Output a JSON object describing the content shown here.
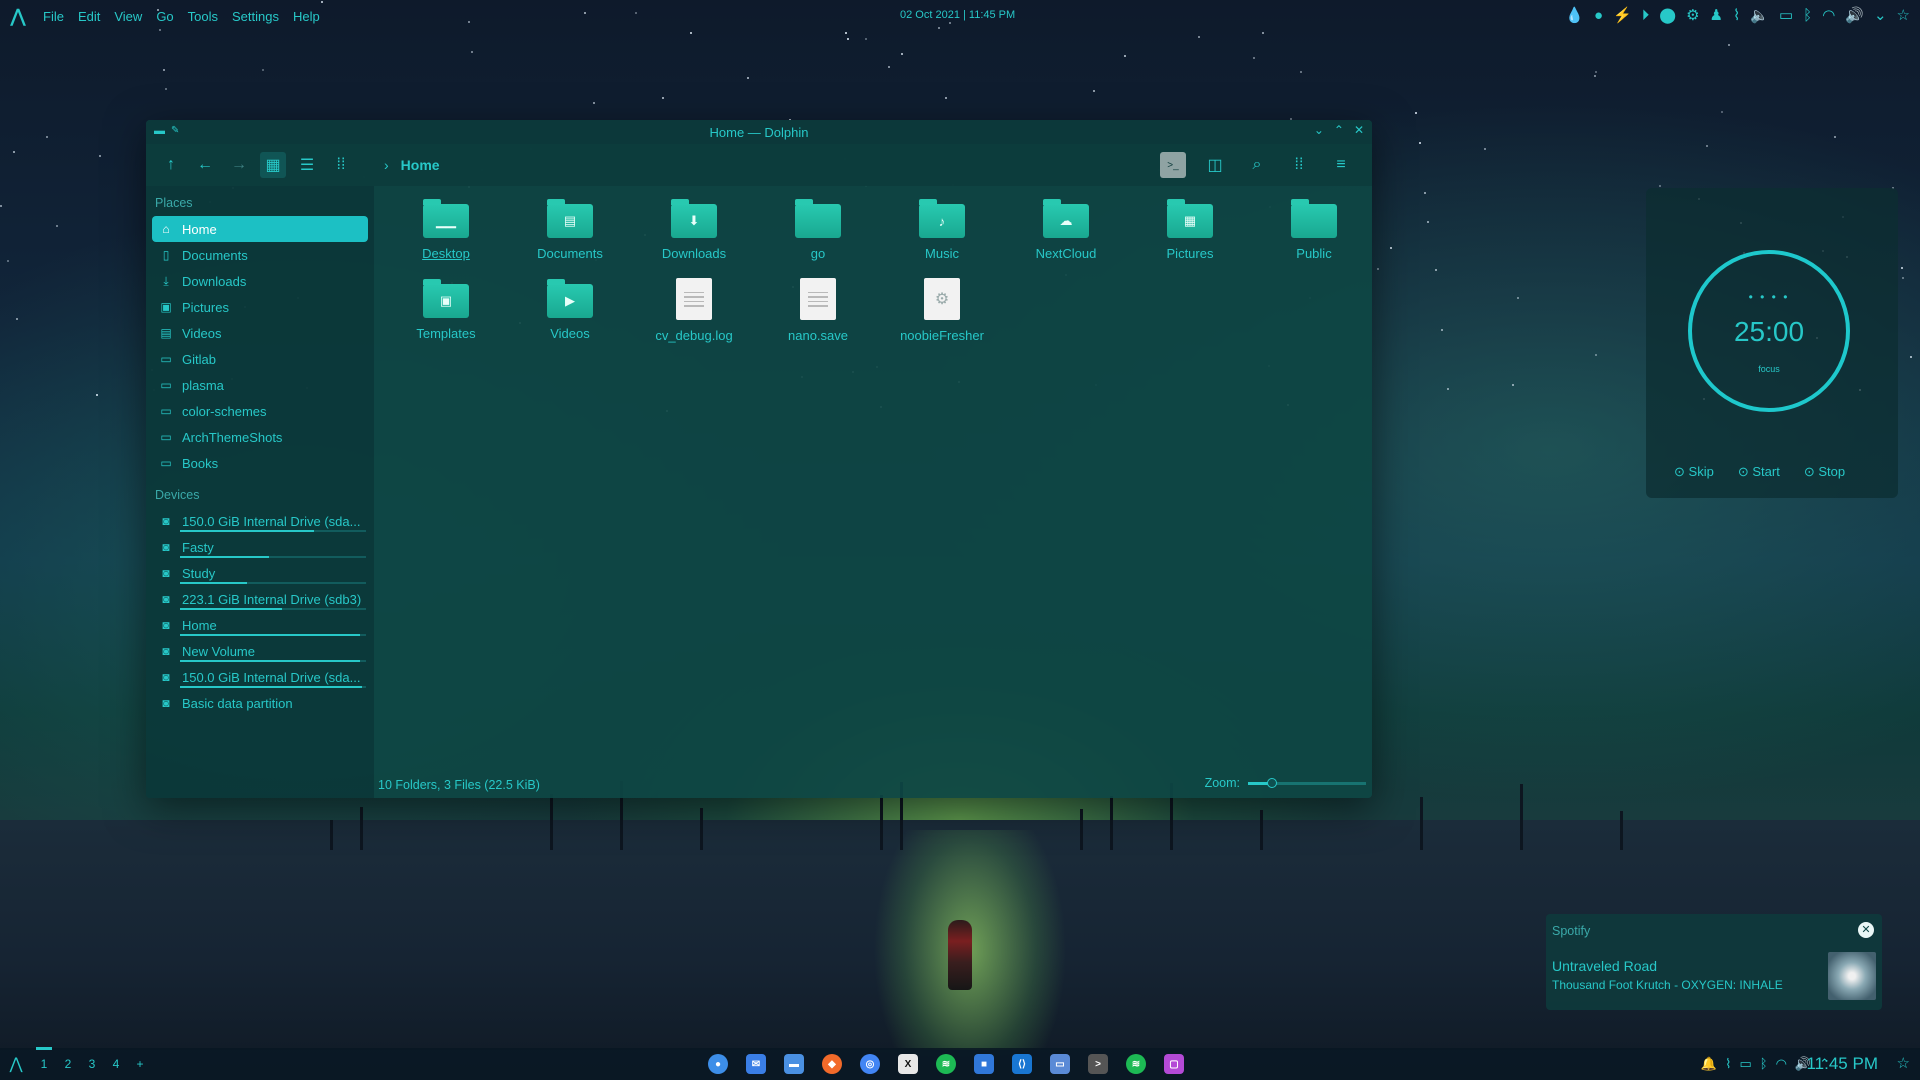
{
  "topbar": {
    "menu": [
      "File",
      "Edit",
      "View",
      "Go",
      "Tools",
      "Settings",
      "Help"
    ],
    "datetime": "02 Oct 2021 | 11:45 PM"
  },
  "window": {
    "title": "Home — Dolphin",
    "breadcrumb": "Home",
    "places_title": "Places",
    "places": [
      {
        "label": "Home",
        "icon": "home-icon"
      },
      {
        "label": "Documents",
        "icon": "document-icon"
      },
      {
        "label": "Downloads",
        "icon": "download-icon"
      },
      {
        "label": "Pictures",
        "icon": "image-icon"
      },
      {
        "label": "Videos",
        "icon": "film-icon"
      },
      {
        "label": "Gitlab",
        "icon": "folder-icon"
      },
      {
        "label": "plasma",
        "icon": "folder-icon"
      },
      {
        "label": "color-schemes",
        "icon": "folder-icon"
      },
      {
        "label": "ArchThemeShots",
        "icon": "folder-icon"
      },
      {
        "label": "Books",
        "icon": "folder-icon"
      }
    ],
    "devices_title": "Devices",
    "devices": [
      {
        "label": "150.0 GiB Internal Drive (sda...",
        "usage": 0.72
      },
      {
        "label": "Fasty",
        "usage": 0.48
      },
      {
        "label": "Study",
        "usage": 0.36
      },
      {
        "label": "223.1 GiB Internal Drive (sdb3)",
        "usage": 0.55
      },
      {
        "label": "Home",
        "usage": 0.97
      },
      {
        "label": "New Volume",
        "usage": 0.97
      },
      {
        "label": "150.0 GiB Internal Drive (sda...",
        "usage": 0.98
      },
      {
        "label": "Basic data partition",
        "usage": 0
      }
    ],
    "items": [
      {
        "label": "Desktop",
        "type": "folder",
        "glyph": "▁▁"
      },
      {
        "label": "Documents",
        "type": "folder",
        "glyph": "▤"
      },
      {
        "label": "Downloads",
        "type": "folder",
        "glyph": "⬇"
      },
      {
        "label": "go",
        "type": "folder",
        "glyph": ""
      },
      {
        "label": "Music",
        "type": "folder",
        "glyph": "♪"
      },
      {
        "label": "NextCloud",
        "type": "folder",
        "glyph": "☁"
      },
      {
        "label": "Pictures",
        "type": "folder",
        "glyph": "▦"
      },
      {
        "label": "Public",
        "type": "folder",
        "glyph": ""
      },
      {
        "label": "Templates",
        "type": "folder",
        "glyph": "▣"
      },
      {
        "label": "Videos",
        "type": "folder",
        "glyph": "▶"
      },
      {
        "label": "cv_debug.log",
        "type": "file",
        "glyph": ""
      },
      {
        "label": "nano.save",
        "type": "file",
        "glyph": ""
      },
      {
        "label": "noobieFresher",
        "type": "file",
        "glyph": "⚙"
      }
    ],
    "status": "10 Folders, 3 Files (22.5 KiB)",
    "zoom_label": "Zoom:",
    "zoom_level": 0.2
  },
  "pomodoro": {
    "dots": "• • • •",
    "time": "25:00",
    "mode": "focus",
    "skip": "Skip",
    "start": "Start",
    "stop": "Stop"
  },
  "notification": {
    "app": "Spotify",
    "song": "Untraveled Road",
    "artist": "Thousand Foot Krutch - OXYGEN: INHALE"
  },
  "taskbar": {
    "desktops": [
      "1",
      "2",
      "3",
      "4"
    ],
    "add": "+",
    "time": "11:45 PM"
  },
  "colors": {
    "accent": "#27c8c8",
    "active_item": "#1cc0c4",
    "folder": "#28c9b0"
  }
}
